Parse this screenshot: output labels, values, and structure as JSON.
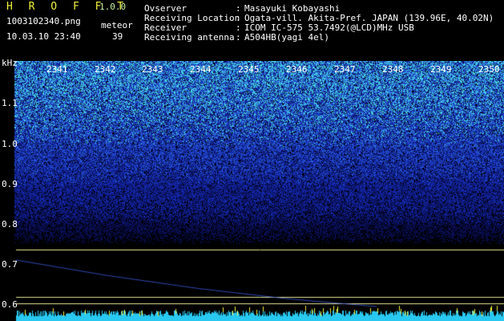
{
  "header": {
    "title": "H R O F F T",
    "version": "1.0.0",
    "filename": "1003102340.png",
    "meteor_label": "meteor",
    "datetime": "10.03.10 23:40",
    "meteor_count": "39"
  },
  "info": [
    {
      "label": "Ovserver",
      "value": "Masayuki Kobayashi"
    },
    {
      "label": "Receiving Location",
      "value": "Ogata-vill. Akita-Pref. JAPAN (139.96E, 40.02N)"
    },
    {
      "label": "Receiver",
      "value": "ICOM IC-575 53.7492(@LCD)MHz USB"
    },
    {
      "label": "Receiving antenna",
      "value": "A504HB(yagi 4el)"
    }
  ],
  "plot": {
    "y_unit": "kHz",
    "y_ticks": [
      "1.1",
      "1.0",
      "0.9",
      "0.8",
      "0.7",
      "0.6"
    ],
    "x_ticks": [
      "2341",
      "2342",
      "2343",
      "2344",
      "2345",
      "2346",
      "2347",
      "2348",
      "2349",
      "2350"
    ]
  },
  "colors": {
    "background": "#000000",
    "title": "#f0f03c",
    "noise_deep": "#1a3cc8",
    "noise_bright": "#46d2e6",
    "marker_line": "#e6e696",
    "bottom_bar": "#28c8f0"
  }
}
